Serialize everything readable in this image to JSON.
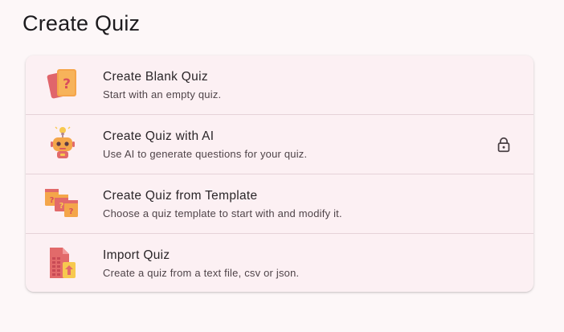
{
  "page": {
    "title": "Create Quiz"
  },
  "options": [
    {
      "title": "Create Blank Quiz",
      "subtitle": "Start with an empty quiz.",
      "icon": "blank-quiz-cards-icon"
    },
    {
      "title": "Create Quiz with AI",
      "subtitle": "Use AI to generate questions for your quiz.",
      "icon": "ai-robot-icon",
      "locked": true,
      "trailing_icon": "lock-icon"
    },
    {
      "title": "Create Quiz from Template",
      "subtitle": "Choose a quiz template to start with and modify it.",
      "icon": "template-cards-icon"
    },
    {
      "title": "Import Quiz",
      "subtitle": "Create a quiz from a text file, csv or json.",
      "icon": "import-file-icon"
    }
  ],
  "colors": {
    "background": "#fdf7f8",
    "card": "#fcf0f3",
    "divider": "#e6d2d8",
    "icon_red": "#e26a6a",
    "icon_orange": "#f4a64a",
    "icon_yellow": "#f7c94f"
  }
}
